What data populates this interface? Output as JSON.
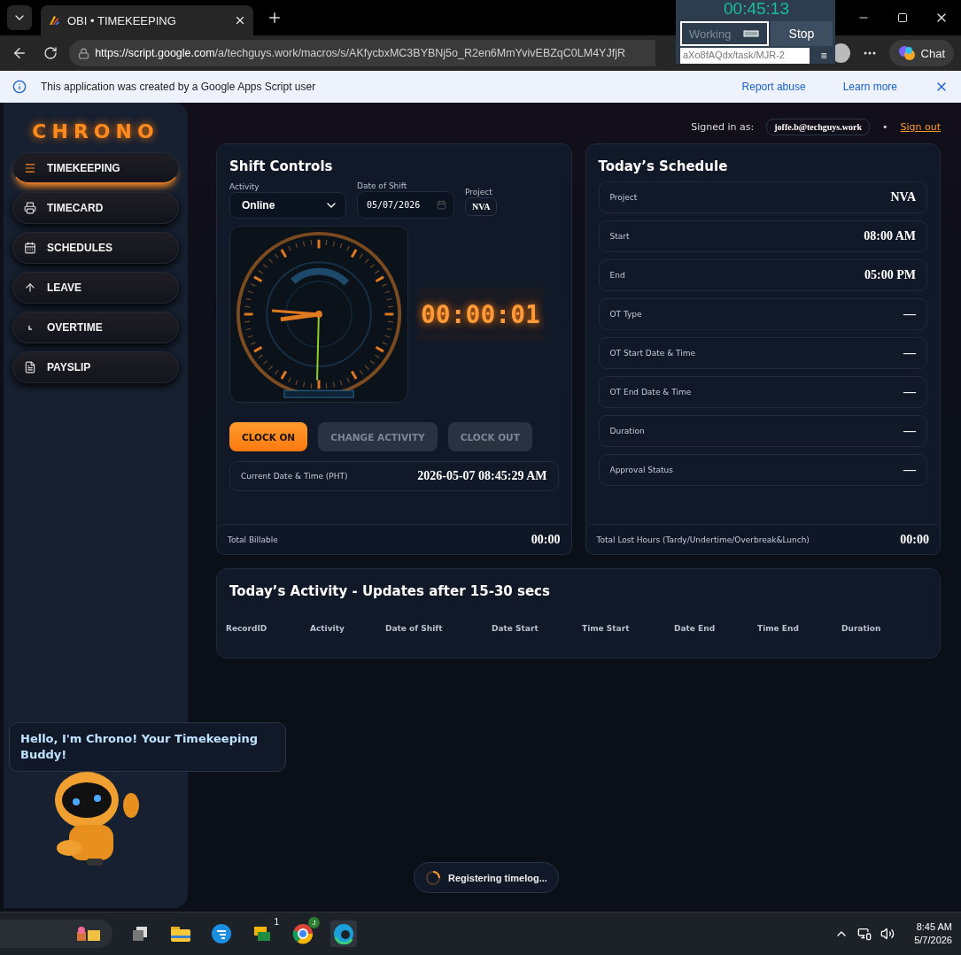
{
  "browser": {
    "tab_title": "OBI • TIMEKEEPING",
    "url_host": "https://script.google.com",
    "url_path": "/a/techguys.work/macros/s/AKfycbxMC3BYBNj5o_R2en6MmYvivEBZqC0LM4YJfjR",
    "chat_label": "Chat"
  },
  "timer_widget": {
    "time": "00:45:13",
    "status_placeholder": "Working",
    "stop_label": "Stop",
    "task_value": "aXo8fAQdx/task/MJR-2",
    "menu_glyph": "≡"
  },
  "info_bar": {
    "message": "This application was created by a Google Apps Script user",
    "links": [
      "Report abuse",
      "Learn more"
    ]
  },
  "brand": "CHRONO",
  "nav": [
    {
      "label": "TIMEKEEPING",
      "selected": true
    },
    {
      "label": "TIMECARD",
      "selected": false
    },
    {
      "label": "SCHEDULES",
      "selected": false
    },
    {
      "label": "LEAVE",
      "selected": false
    },
    {
      "label": "OVERTIME",
      "selected": false
    },
    {
      "label": "PAYSLIP",
      "selected": false
    }
  ],
  "account": {
    "label": "Signed in as:",
    "email": "joffe.b@techguys.work",
    "separator": "•",
    "sign_out": "Sign out"
  },
  "shift_controls": {
    "title": "Shift Controls",
    "activity_label": "Activity",
    "activity_value": "Online",
    "date_label": "Date of Shift",
    "date_value": "05/07/2026",
    "project_label": "Project",
    "project_value": "NVA",
    "timer": "00:00:01",
    "buttons": [
      {
        "label": "CLOCK ON",
        "disabled": false
      },
      {
        "label": "CHANGE ACTIVITY",
        "disabled": true
      },
      {
        "label": "CLOCK OUT",
        "disabled": true
      }
    ],
    "current_label": "Current Date & Time (PHT)",
    "current_value": "2026-05-07 08:45:29 AM",
    "total_label": "Total Billable",
    "total_value": "00:00"
  },
  "schedule": {
    "title": "Today’s Schedule",
    "rows": [
      {
        "label": "Project",
        "value": "NVA"
      },
      {
        "label": "Start",
        "value": "08:00 AM"
      },
      {
        "label": "End",
        "value": "05:00 PM"
      },
      {
        "label": "OT Type",
        "value": "—"
      },
      {
        "label": "OT Start Date & Time",
        "value": "—"
      },
      {
        "label": "OT End Date & Time",
        "value": "—"
      },
      {
        "label": "Duration",
        "value": "—"
      },
      {
        "label": "Approval Status",
        "value": "—"
      }
    ],
    "total_label": "Total Lost Hours (Tardy/Undertime/Overbreak&Lunch)",
    "total_value": "00:00"
  },
  "activity": {
    "title": "Today’s Activity - Updates after 15-30 secs",
    "columns": [
      "RecordID",
      "Activity",
      "Date of Shift",
      "Date Start",
      "Time Start",
      "Date End",
      "Time End",
      "Duration"
    ]
  },
  "assistant": {
    "message": "Hello, I'm Chrono! Your Timekeeping Buddy!"
  },
  "toast": {
    "message": "Registering timelog..."
  },
  "taskbar": {
    "messenger_badge": "1",
    "browser_badge": "J",
    "time": "8:45 AM",
    "date": "5/7/2026"
  }
}
